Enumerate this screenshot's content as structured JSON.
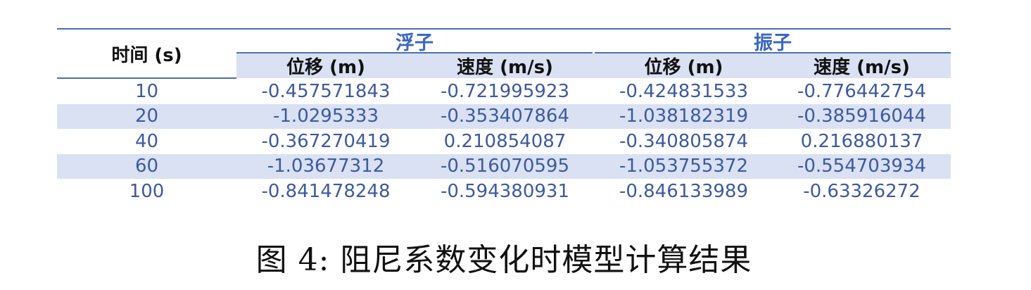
{
  "chart_data": {
    "type": "table",
    "row_header": "时间 (s)",
    "column_groups": [
      {
        "name": "浮子",
        "columns": [
          "位移 (m)",
          "速度 (m/s)"
        ]
      },
      {
        "name": "振子",
        "columns": [
          "位移 (m)",
          "速度 (m/s)"
        ]
      }
    ],
    "rows": [
      {
        "time": "10",
        "values": [
          "-0.457571843",
          "-0.721995923",
          "-0.424831533",
          "-0.776442754"
        ]
      },
      {
        "time": "20",
        "values": [
          "-1.0295333",
          "-0.353407864",
          "-1.038182319",
          "-0.385916044"
        ]
      },
      {
        "time": "40",
        "values": [
          "-0.367270419",
          "0.210854087",
          "-0.340805874",
          "0.216880137"
        ]
      },
      {
        "time": "60",
        "values": [
          "-1.03677312",
          "-0.516070595",
          "-1.053755372",
          "-0.554703934"
        ]
      },
      {
        "time": "100",
        "values": [
          "-0.841478248",
          "-0.594380931",
          "-0.846133989",
          "-0.63326272"
        ]
      }
    ],
    "banded_rows": [
      1,
      3
    ]
  },
  "caption": "图 4: 阻尼系数变化时模型计算结果",
  "colors": {
    "header_rule": "#4a6fb5",
    "band": "#d9e1f2",
    "group_text": "#3a66c4",
    "value_text": "#3d5aa0"
  }
}
